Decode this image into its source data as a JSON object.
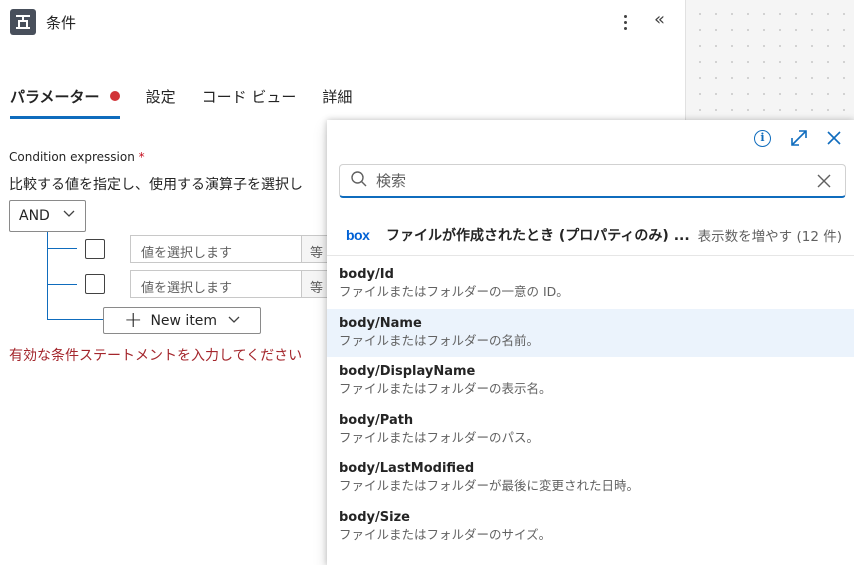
{
  "header": {
    "title": "条件"
  },
  "tabs": [
    {
      "label": "パラメーター"
    },
    {
      "label": "設定"
    },
    {
      "label": "コード ビュー"
    },
    {
      "label": "詳細"
    }
  ],
  "condition": {
    "label": "Condition expression",
    "required_mark": "*",
    "description": "比較する値を指定し、使用する演算子を選択し",
    "group_operator": "AND",
    "rows": [
      {
        "placeholder": "値を選択します",
        "operator": "等"
      },
      {
        "placeholder": "値を選択します",
        "operator": "等"
      }
    ],
    "new_item_label": "New item",
    "error_message": "有効な条件ステートメントを入力してください"
  },
  "popup": {
    "search_placeholder": "検索",
    "source": {
      "logo_text": "box",
      "title": "ファイルが作成されたとき (プロパティのみ) ...",
      "more_label": "表示数を増やす (12 件)"
    },
    "items": [
      {
        "name": "body/Id",
        "desc": "ファイルまたはフォルダーの一意の ID。"
      },
      {
        "name": "body/Name",
        "desc": "ファイルまたはフォルダーの名前。"
      },
      {
        "name": "body/DisplayName",
        "desc": "ファイルまたはフォルダーの表示名。"
      },
      {
        "name": "body/Path",
        "desc": "ファイルまたはフォルダーのパス。"
      },
      {
        "name": "body/LastModified",
        "desc": "ファイルまたはフォルダーが最後に変更された日時。"
      },
      {
        "name": "body/Size",
        "desc": "ファイルまたはフォルダーのサイズ。"
      }
    ]
  },
  "colors": {
    "accent": "#0f6cbd",
    "error": "#d13438",
    "box_brand": "#0061d5"
  },
  "icons": [
    "condition-icon",
    "more-icon",
    "collapse-icon",
    "info-icon",
    "expand-icon",
    "close-icon",
    "search-icon",
    "clear-icon",
    "chevron-down-icon",
    "plus-icon"
  ]
}
